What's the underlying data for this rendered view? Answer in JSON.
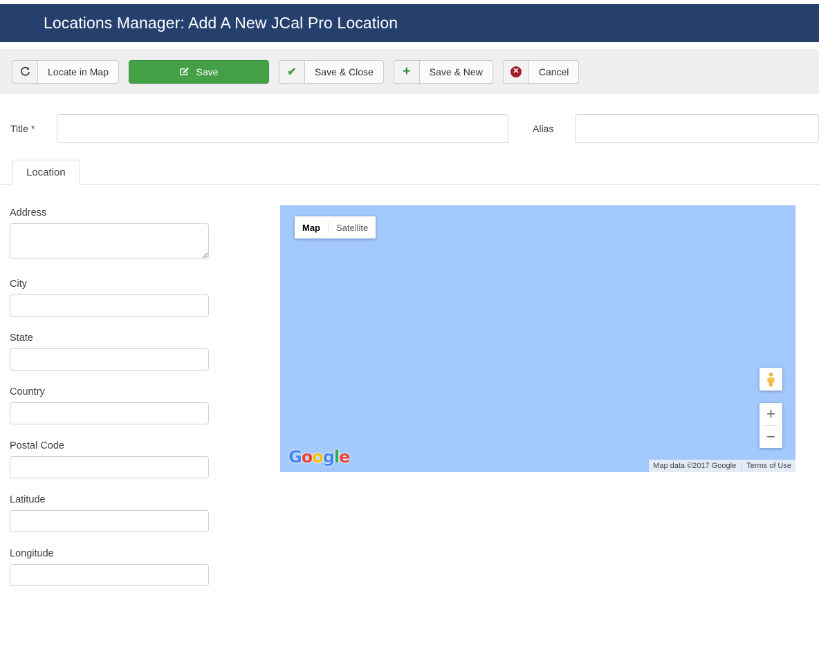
{
  "header": {
    "title": "Locations Manager: Add A New JCal Pro Location",
    "background_color": "#26406e",
    "text_color": "#ffffff"
  },
  "toolbar": {
    "background_color": "#efefef",
    "buttons": [
      {
        "icon": "redo-arrow-icon",
        "glyph": "⟳",
        "label": "Locate in Map",
        "style": "default"
      },
      {
        "icon": "edit-pencil-icon",
        "glyph": "✎",
        "label": "Save",
        "style": "primary-green",
        "color": "#43a047"
      },
      {
        "icon": "check-icon",
        "glyph": "✔",
        "label": "Save & Close",
        "style": "default",
        "icon_color": "#3f9c42"
      },
      {
        "icon": "plus-icon",
        "glyph": "+",
        "label": "Save & New",
        "style": "default",
        "icon_color": "#2e8b33"
      },
      {
        "icon": "cancel-circle-icon",
        "glyph": "✕",
        "label": "Cancel",
        "style": "default",
        "icon_color": "#a02128"
      }
    ]
  },
  "title_row": {
    "title_label": "Title *",
    "title_value": "",
    "title_placeholder": "",
    "alias_label": "Alias",
    "alias_value": "",
    "alias_placeholder": ""
  },
  "tabs": [
    {
      "label": "Location",
      "active": true
    }
  ],
  "form": {
    "fields": [
      {
        "label": "Address",
        "type": "textarea",
        "value": "",
        "name": "address"
      },
      {
        "label": "City",
        "type": "text",
        "value": "",
        "name": "city"
      },
      {
        "label": "State",
        "type": "text",
        "value": "",
        "name": "state"
      },
      {
        "label": "Country",
        "type": "text",
        "value": "",
        "name": "country"
      },
      {
        "label": "Postal Code",
        "type": "text",
        "value": "",
        "name": "postal-code"
      },
      {
        "label": "Latitude",
        "type": "text",
        "value": "",
        "name": "latitude"
      },
      {
        "label": "Longitude",
        "type": "text",
        "value": "",
        "name": "longitude"
      }
    ]
  },
  "map": {
    "background_color": "#a3c8fc",
    "type_buttons": [
      {
        "label": "Map",
        "selected": true
      },
      {
        "label": "Satellite",
        "selected": false
      }
    ],
    "controls": {
      "pegman": "street-view-pegman-icon",
      "zoom_in": "+",
      "zoom_out": "−"
    },
    "logo": {
      "letters": [
        {
          "char": "G",
          "color": "#4285f4"
        },
        {
          "char": "o",
          "color": "#ea4335"
        },
        {
          "char": "o",
          "color": "#fbbc05"
        },
        {
          "char": "g",
          "color": "#4285f4"
        },
        {
          "char": "l",
          "color": "#34a853"
        },
        {
          "char": "e",
          "color": "#ea4335"
        }
      ]
    },
    "attribution": "Map data ©2017 Google",
    "terms_link": "Terms of Use"
  }
}
